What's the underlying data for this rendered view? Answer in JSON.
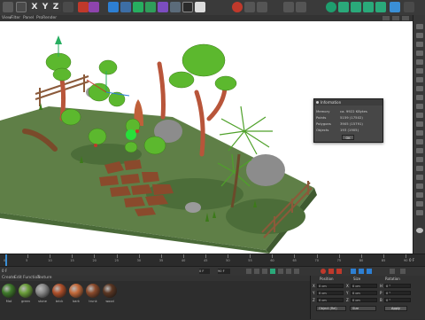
{
  "toolbar": {
    "axis_x": "X",
    "axis_y": "Y",
    "axis_z": "Z"
  },
  "menu": {
    "item1": "View",
    "item2": "Filter",
    "item3": "Panel",
    "item4": "ProRender"
  },
  "info_dialog": {
    "title": "Information",
    "rows": [
      {
        "label": "Memory",
        "value": "ca. 9922 KBytes"
      },
      {
        "label": "Points",
        "value": "5159 (17502)"
      },
      {
        "label": "Polygons",
        "value": "3905 (15791)"
      },
      {
        "label": "Objects",
        "value": "193 (1905)"
      }
    ],
    "ok": "OK"
  },
  "timeline": {
    "ticks": [
      "0",
      "5",
      "10",
      "15",
      "20",
      "25",
      "30",
      "35",
      "40",
      "45",
      "50",
      "55",
      "60",
      "65",
      "70",
      "75",
      "80",
      "85",
      "90"
    ],
    "current_frame": "0 F",
    "end_frame": "90 F",
    "frame_field_a": "0 F",
    "frame_field_b": "90 F"
  },
  "materials": {
    "menu": [
      "Create",
      "Edit",
      "Function",
      "Texture"
    ],
    "items": [
      {
        "name": "Mat",
        "color": "#3f7a2a"
      },
      {
        "name": "green",
        "color": "#6b9e3a"
      },
      {
        "name": "stone",
        "color": "#8a8a8a"
      },
      {
        "name": "brick",
        "color": "#b0502a"
      },
      {
        "name": "bark",
        "color": "#c46a3a"
      },
      {
        "name": "trunk",
        "color": "#8b4a2b"
      },
      {
        "name": "wood",
        "color": "#5a3622"
      }
    ]
  },
  "coordinates": {
    "position": "Position",
    "size": "Size",
    "rotation": "Rotation",
    "rows": [
      {
        "axis": "X",
        "pos": "0 cm",
        "size": "0 cm",
        "rot_axis": "H",
        "rot": "0 °"
      },
      {
        "axis": "Y",
        "pos": "0 cm",
        "size": "0 cm",
        "rot_axis": "P",
        "rot": "0 °"
      },
      {
        "axis": "Z",
        "pos": "0 cm",
        "size": "0 cm",
        "rot_axis": "B",
        "rot": "0 °"
      }
    ],
    "mode_dropdown": "Object (Rel)",
    "size_dropdown": "Size",
    "apply": "Apply"
  },
  "colors": {
    "ground": "#5f7f47",
    "ground_dark": "#4c6d39",
    "foliage": "#5cb82e",
    "trunk": "#b8553a",
    "rock": "#8c8c8c",
    "bricks": "#8a4a2c",
    "accent_red": "#c0392b",
    "accent_green": "#27ae60"
  }
}
